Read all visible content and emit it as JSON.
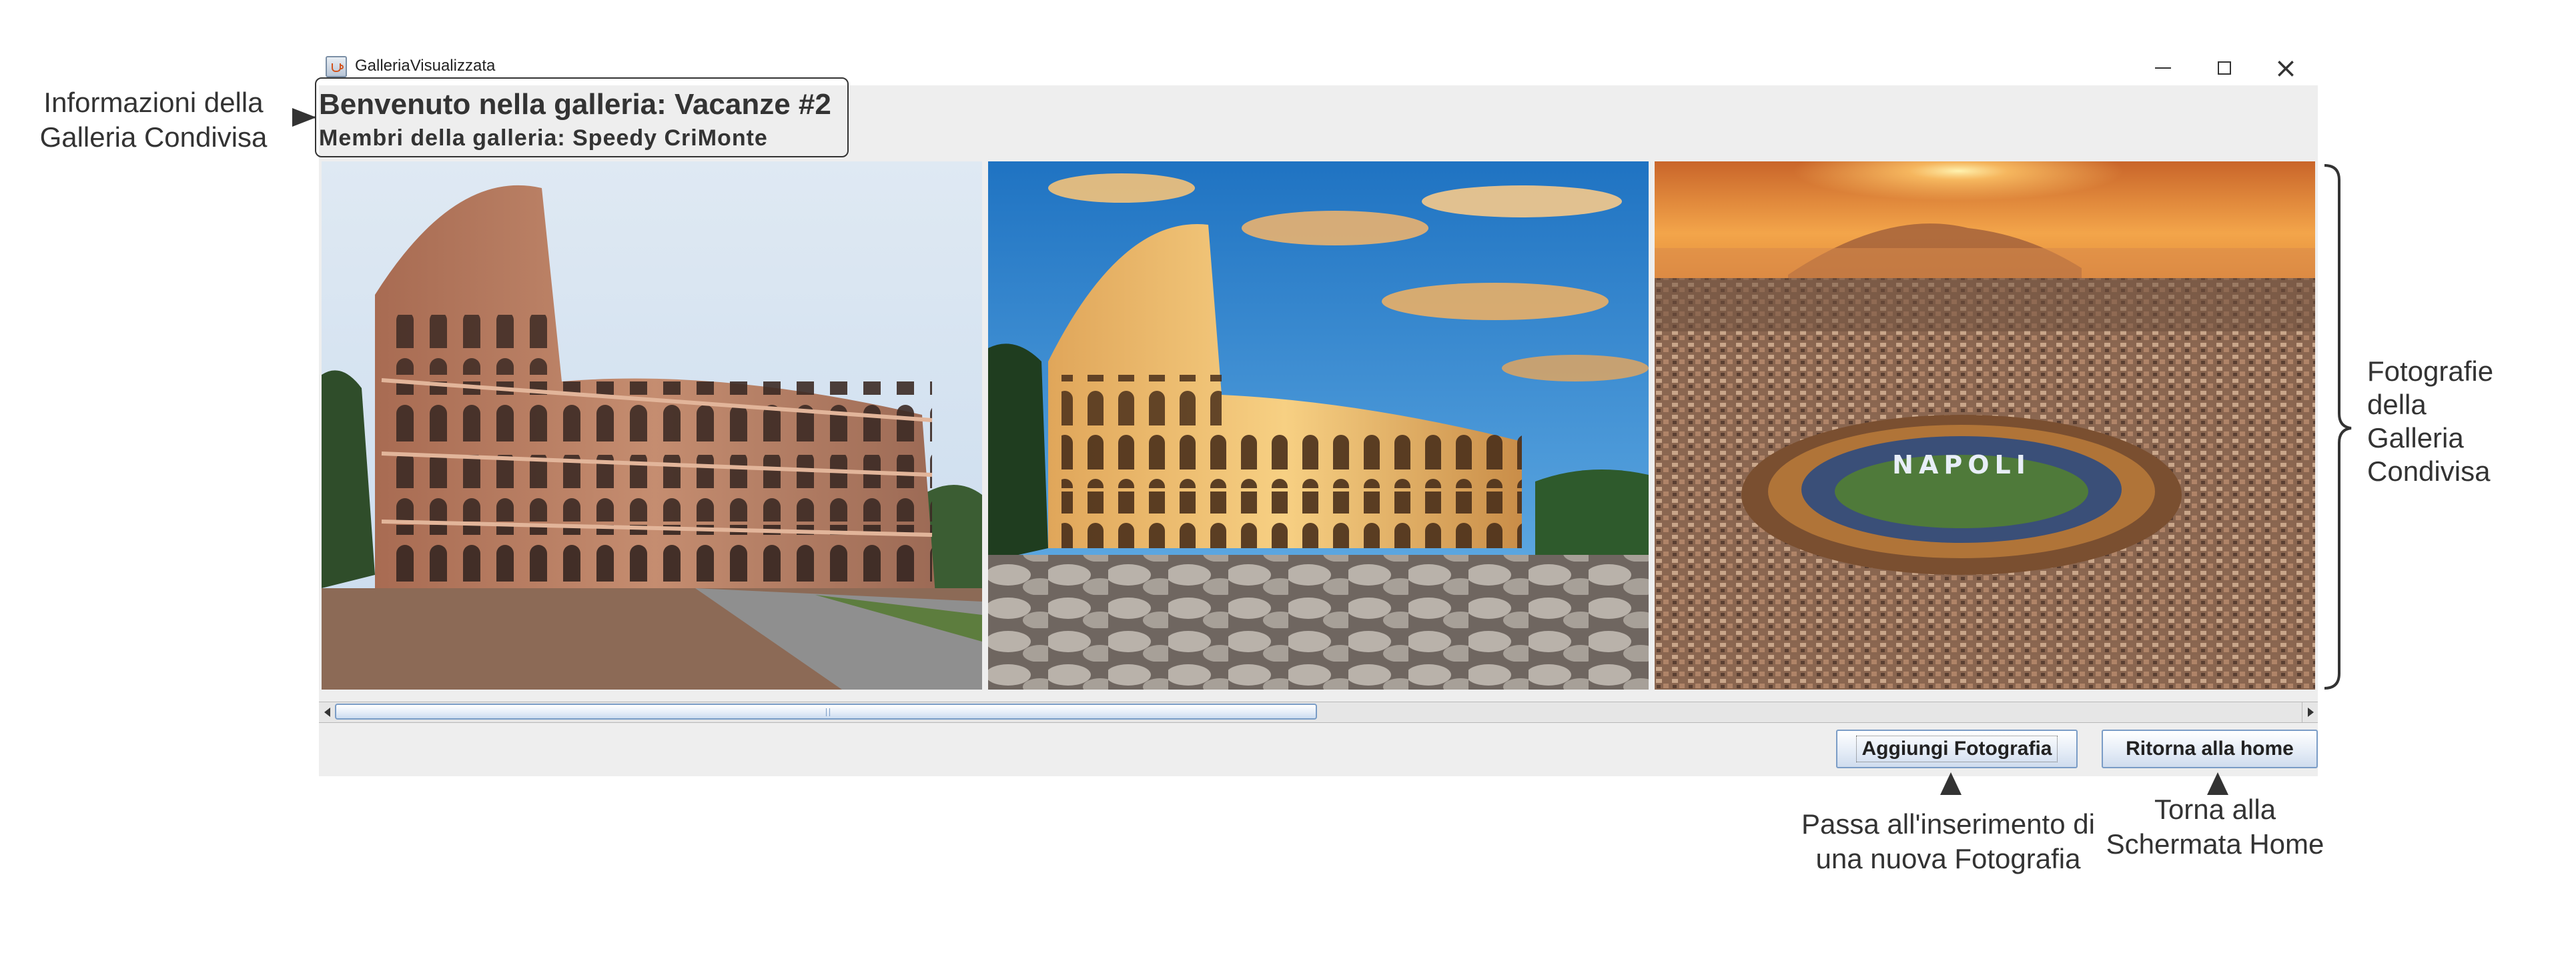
{
  "window": {
    "title": "GalleriaVisualizzata",
    "controls": {
      "minimize": "minimize-icon",
      "maximize": "maximize-icon",
      "close": "close-icon"
    }
  },
  "gallery": {
    "welcome": "Benvenuto nella galleria: Vacanze #2",
    "members": "Membri della galleria: Speedy CriMonte",
    "photos": [
      {
        "subject": "colosseum-daylight-photo"
      },
      {
        "subject": "colosseum-sunset-photo"
      },
      {
        "subject": "naples-stadium-aerial-photo",
        "stadium_text": "NAPOLI"
      }
    ],
    "scroll_position_percent": 0
  },
  "buttons": {
    "add_photo": "Aggiungi Fotografia",
    "home": "Ritorna alla home"
  },
  "annotations": {
    "info_line1": "Informazioni della",
    "info_line2": "Galleria Condivisa",
    "photos_line1": "Fotografie",
    "photos_line2": "della",
    "photos_line3": "Galleria",
    "photos_line4": "Condivisa",
    "add_line1": "Passa all'inserimento di",
    "add_line2": "una nuova Fotografia",
    "home_line1": "Torna alla",
    "home_line2": "Schermata Home"
  },
  "colors": {
    "window_bg": "#eeeeee",
    "button_border": "#7a9cc6",
    "annotation_text": "#333333"
  }
}
